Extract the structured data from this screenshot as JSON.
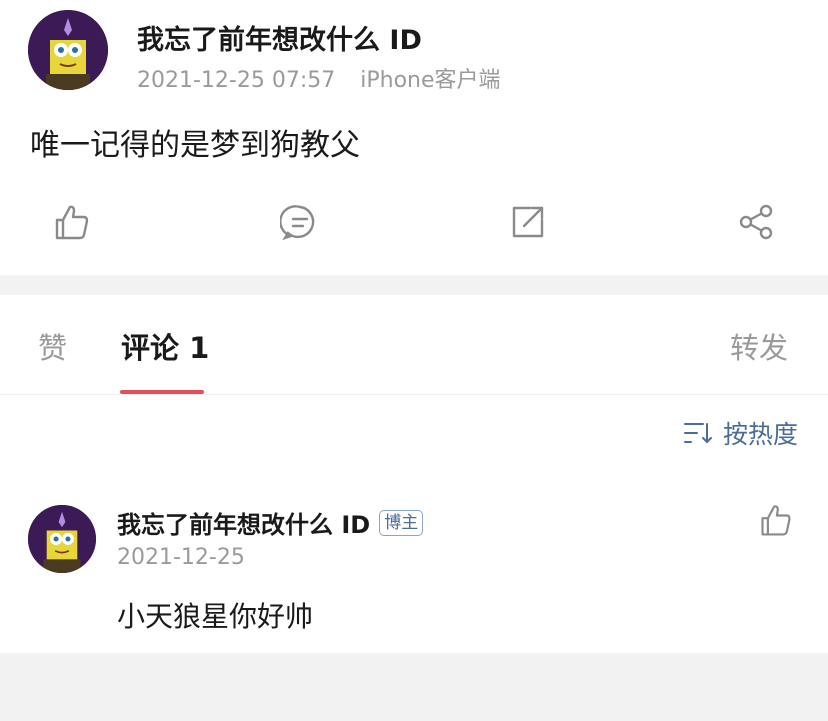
{
  "post": {
    "author": "我忘了前年想改什么 ID",
    "timestamp": "2021-12-25 07:57",
    "source": "iPhone客户端",
    "text": "唯一记得的是梦到狗教父",
    "actions": [
      "like-icon",
      "comment-icon",
      "repost-icon",
      "share-icon"
    ]
  },
  "tabs": {
    "likes_label": "赞",
    "comments_label": "评论 1",
    "reposts_label": "转发",
    "active": "comments"
  },
  "sort": {
    "label": "按热度",
    "icon": "sort-icon"
  },
  "comments": [
    {
      "author": "我忘了前年想改什么 ID",
      "badge": "博主",
      "date": "2021-12-25",
      "text": "小天狼星你好帅"
    }
  ],
  "colors": {
    "accent_underline": "#e0505a",
    "link_blue": "#4a6d97",
    "muted": "#9a9a9a"
  }
}
